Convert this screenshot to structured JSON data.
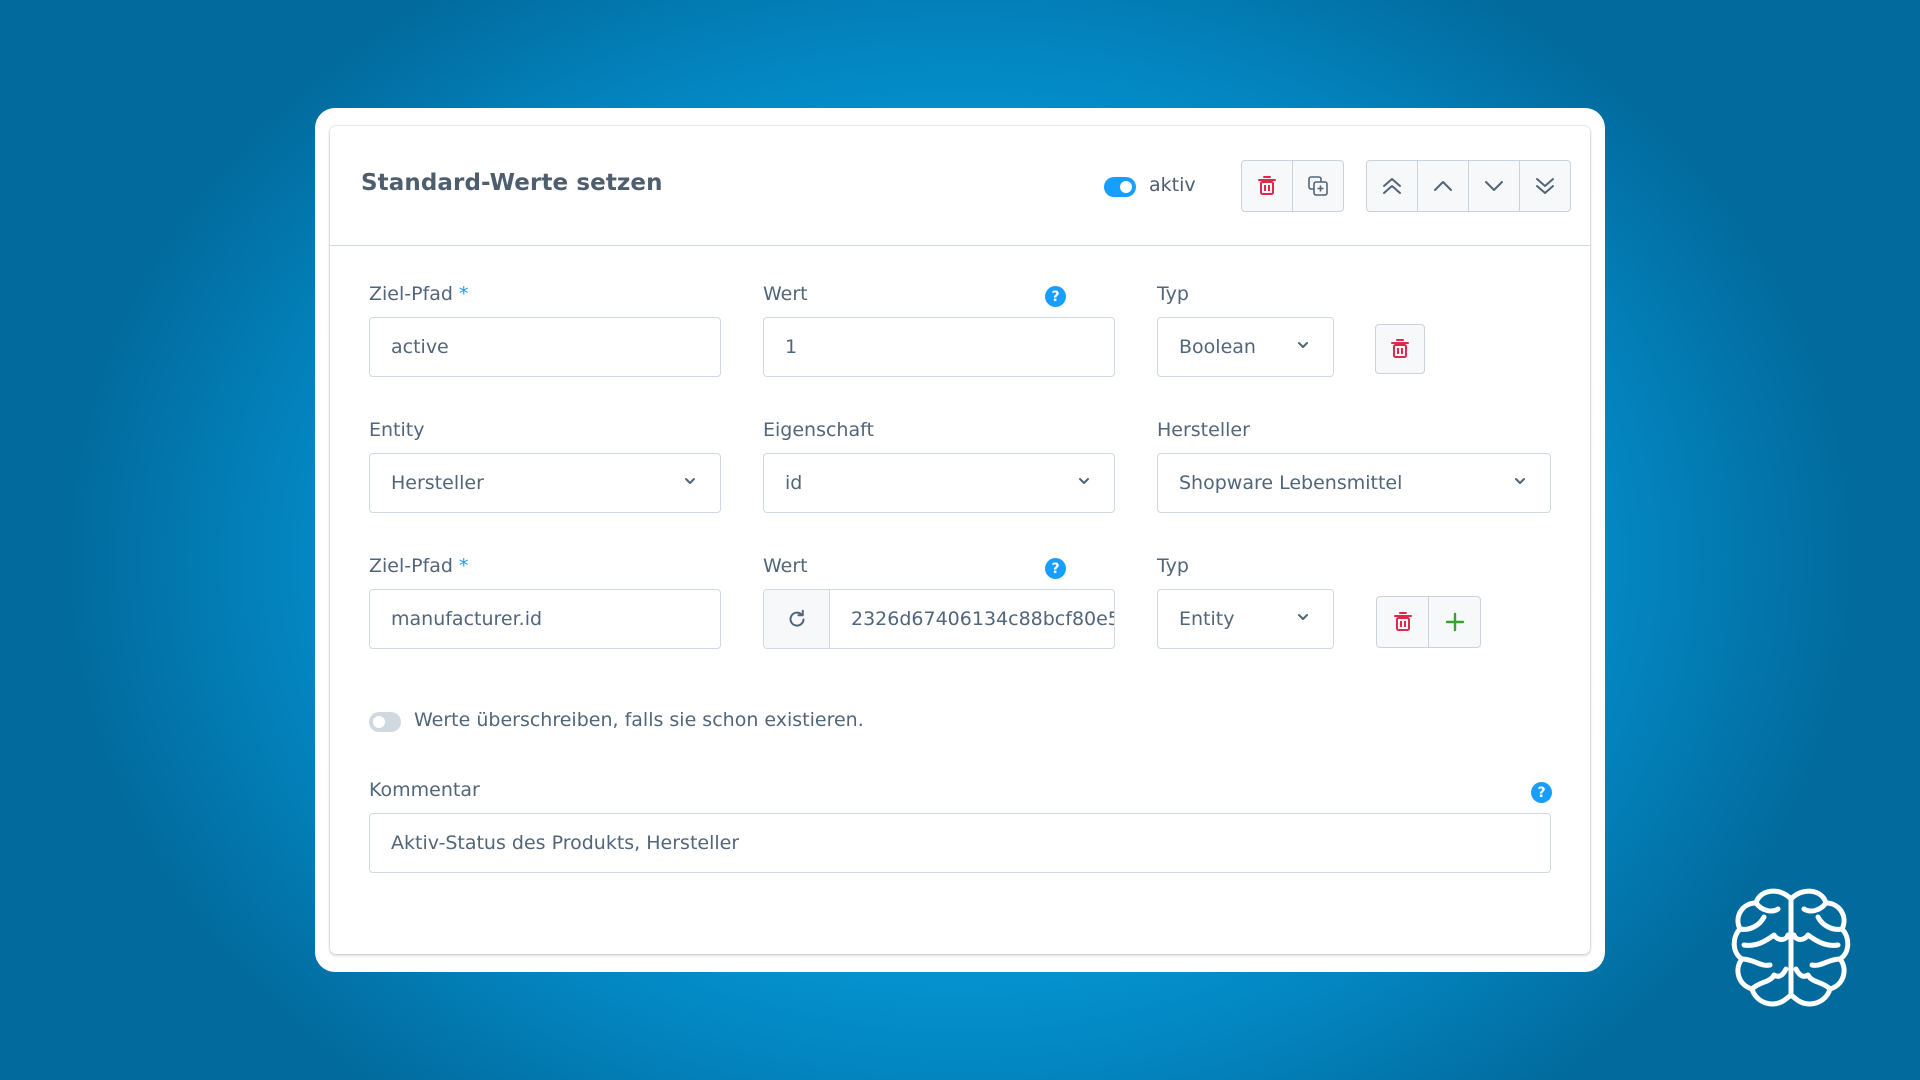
{
  "card": {
    "title": "Standard-Werte setzen",
    "active_label": "aktiv",
    "active": true
  },
  "row1": {
    "target_label": "Ziel-Pfad",
    "required_mark": "*",
    "help_glyph": "?",
    "target_value": "active",
    "value_label": "Wert",
    "value": "1",
    "type_label": "Typ",
    "type_value": "Boolean"
  },
  "entity_row": {
    "entity_label": "Entity",
    "entity_value": "Hersteller",
    "property_label": "Eigenschaft",
    "property_value": "id",
    "manufacturer_label": "Hersteller",
    "manufacturer_value": "Shopware Lebensmittel"
  },
  "row2": {
    "target_label": "Ziel-Pfad",
    "required_mark": "*",
    "help_glyph": "?",
    "target_value": "manufacturer.id",
    "value_label": "Wert",
    "value": "2326d67406134c88bcf80e5",
    "type_label": "Typ",
    "type_value": "Entity"
  },
  "overwrite": {
    "label": "Werte überschreiben, falls sie schon existieren.",
    "enabled": false
  },
  "comment": {
    "label": "Kommentar",
    "help_glyph": "?",
    "value": "Aktiv-Status des Produkts, Hersteller"
  },
  "colors": {
    "accent": "#189eff",
    "danger": "#de294c",
    "success": "#37a32f"
  },
  "icons": {
    "delete": "trash-icon",
    "duplicate": "duplicate-icon",
    "move_top": "double-chevron-up-icon",
    "move_up": "chevron-up-icon",
    "move_down": "chevron-down-icon",
    "move_bottom": "double-chevron-down-icon",
    "refresh": "refresh-icon",
    "add": "plus-icon",
    "logo": "brain-icon"
  }
}
